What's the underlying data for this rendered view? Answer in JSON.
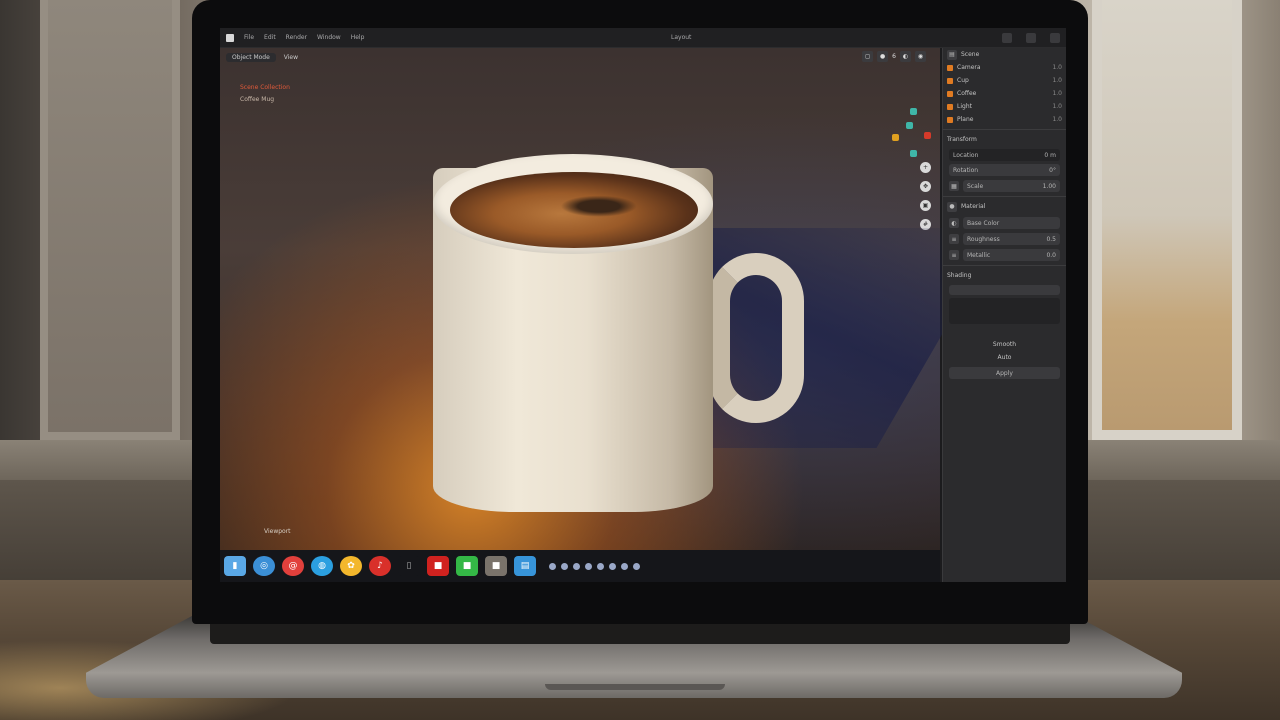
{
  "menubar": {
    "items": [
      "File",
      "Edit",
      "Render",
      "Window",
      "Help"
    ],
    "title": "Layout"
  },
  "viewport": {
    "mode": "Object Mode",
    "view": "View",
    "outliner_lines": [
      "Scene Collection",
      "Coffee Mug"
    ],
    "shading": "6",
    "footer": "Viewport"
  },
  "panel": {
    "header": "Scene",
    "tree": [
      {
        "label": "Camera",
        "val": "1.0"
      },
      {
        "label": "Cup",
        "val": "1.0"
      },
      {
        "label": "Coffee",
        "val": "1.0"
      },
      {
        "label": "Light",
        "val": "1.0"
      },
      {
        "label": "Plane",
        "val": "1.0"
      }
    ],
    "section1": "Transform",
    "fields": [
      {
        "label": "Location",
        "val": "0 m"
      },
      {
        "label": "Rotation",
        "val": "0°"
      },
      {
        "label": "Scale",
        "val": "1.00"
      }
    ],
    "section2": "Material",
    "mat_fields": [
      {
        "label": "Base Color",
        "val": ""
      },
      {
        "label": "Roughness",
        "val": "0.5"
      },
      {
        "label": "Metallic",
        "val": "0.0"
      }
    ],
    "section3": "Shading",
    "bottom_labels": [
      "Smooth",
      "Auto"
    ],
    "bottom_button": "Apply"
  },
  "taskbar": {
    "icons": [
      "files-icon",
      "browser-icon",
      "mail-icon",
      "globe-icon",
      "photos-icon",
      "music-icon",
      "terminal-icon",
      "red-app-icon",
      "green-app-icon",
      "gray-app-icon",
      "blue-app-icon"
    ]
  },
  "colors": {
    "accent": "#e07b22",
    "panel": "#2b2b2d",
    "taskbar": "#15161a"
  }
}
